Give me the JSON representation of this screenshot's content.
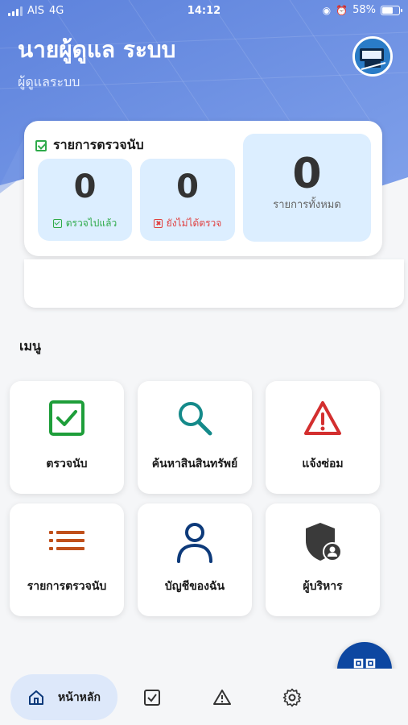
{
  "status_bar": {
    "carrier": "AIS",
    "network": "4G",
    "time": "14:12",
    "battery": "58%",
    "battery_level": 0.58
  },
  "user": {
    "name": "นายผู้ดูแล ระบบ",
    "role": "ผู้ดูแลระบบ"
  },
  "summary": {
    "title": "รายการตรวจนับ",
    "checked": {
      "value": "0",
      "label": "ตรวจไปแล้ว"
    },
    "unchecked": {
      "value": "0",
      "label": "ยังไม่ได้ตรวจ"
    },
    "total": {
      "value": "0",
      "label": "รายการทั้งหมด"
    }
  },
  "menu": {
    "heading": "เมนู",
    "items": [
      {
        "label": "ตรวจนับ",
        "icon": "checkbox-icon",
        "color": "#1e9e3a"
      },
      {
        "label": "ค้นหาสินสินทรัพย์",
        "icon": "search-icon",
        "color": "#158a8a"
      },
      {
        "label": "แจ้งซ่อม",
        "icon": "warning-icon",
        "color": "#d32f2f"
      },
      {
        "label": "รายการตรวจนับ",
        "icon": "list-icon",
        "color": "#c0501b"
      },
      {
        "label": "บัญชีของฉัน",
        "icon": "user-icon",
        "color": "#0d3a7a"
      },
      {
        "label": "ผู้บริหาร",
        "icon": "admin-shield-icon",
        "color": "#3a3a3a"
      }
    ]
  },
  "bottom_nav": {
    "home_label": "หน้าหลัก"
  },
  "colors": {
    "header": "#6b8fe0",
    "accent": "#0d47a1",
    "stat_bg": "#dceeff"
  }
}
